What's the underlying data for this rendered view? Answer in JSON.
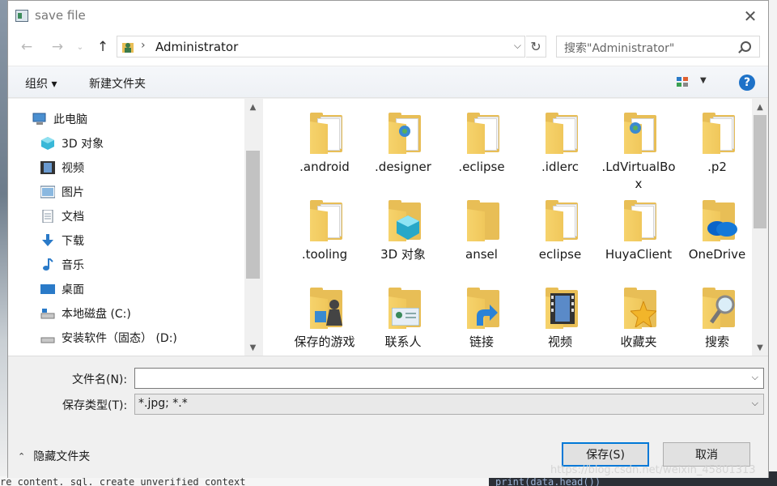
{
  "window": {
    "title": "save file"
  },
  "address": {
    "location": "Administrator"
  },
  "search": {
    "placeholder": "搜索\"Administrator\""
  },
  "toolbar": {
    "organize": "组织 ▾",
    "new_folder": "新建文件夹"
  },
  "sidebar": {
    "items": [
      {
        "label": "此电脑",
        "icon": "computer-icon"
      },
      {
        "label": "3D 对象",
        "icon": "cube-icon"
      },
      {
        "label": "视频",
        "icon": "video-icon"
      },
      {
        "label": "图片",
        "icon": "picture-icon"
      },
      {
        "label": "文档",
        "icon": "document-icon"
      },
      {
        "label": "下载",
        "icon": "download-icon"
      },
      {
        "label": "音乐",
        "icon": "music-icon"
      },
      {
        "label": "桌面",
        "icon": "desktop-icon"
      },
      {
        "label": "本地磁盘 (C:)",
        "icon": "drive-icon"
      },
      {
        "label": "安装软件（固态） (D:)",
        "icon": "drive-icon"
      }
    ]
  },
  "files": [
    {
      "name": ".android",
      "icon": "folder-icon"
    },
    {
      "name": ".designer",
      "icon": "folder-web-icon"
    },
    {
      "name": ".eclipse",
      "icon": "folder-icon"
    },
    {
      "name": ".idlerc",
      "icon": "folder-icon"
    },
    {
      "name": ".LdVirtualBox",
      "icon": "folder-web-icon"
    },
    {
      "name": ".p2",
      "icon": "folder-icon"
    },
    {
      "name": ".tooling",
      "icon": "folder-icon"
    },
    {
      "name": "3D 对象",
      "icon": "folder-3d-icon"
    },
    {
      "name": "ansel",
      "icon": "folder-icon"
    },
    {
      "name": "eclipse",
      "icon": "folder-icon"
    },
    {
      "name": "HuyaClient",
      "icon": "folder-icon"
    },
    {
      "name": "OneDrive",
      "icon": "onedrive-folder-icon"
    },
    {
      "name": "保存的游戏",
      "icon": "saved-games-icon"
    },
    {
      "name": "联系人",
      "icon": "contacts-icon"
    },
    {
      "name": "链接",
      "icon": "links-icon"
    },
    {
      "name": "视频",
      "icon": "videos-folder-icon"
    },
    {
      "name": "收藏夹",
      "icon": "favorites-icon"
    },
    {
      "name": "搜索",
      "icon": "searches-icon"
    }
  ],
  "form": {
    "filename_label": "文件名(N):",
    "filename_value": "",
    "filetype_label": "保存类型(T):",
    "filetype_value": "*.jpg; *.*"
  },
  "footer": {
    "hide_folders": "隐藏文件夹",
    "save": "保存(S)",
    "cancel": "取消"
  },
  "background": {
    "watermark": "https://blog.csdn.net/weixin_45801313",
    "code_text": "print(data.head())",
    "left_text": "re content. sql. create unverified context"
  },
  "colors": {
    "folder": "#e8be56",
    "accent": "#0078d7",
    "help": "#1e72c8"
  }
}
